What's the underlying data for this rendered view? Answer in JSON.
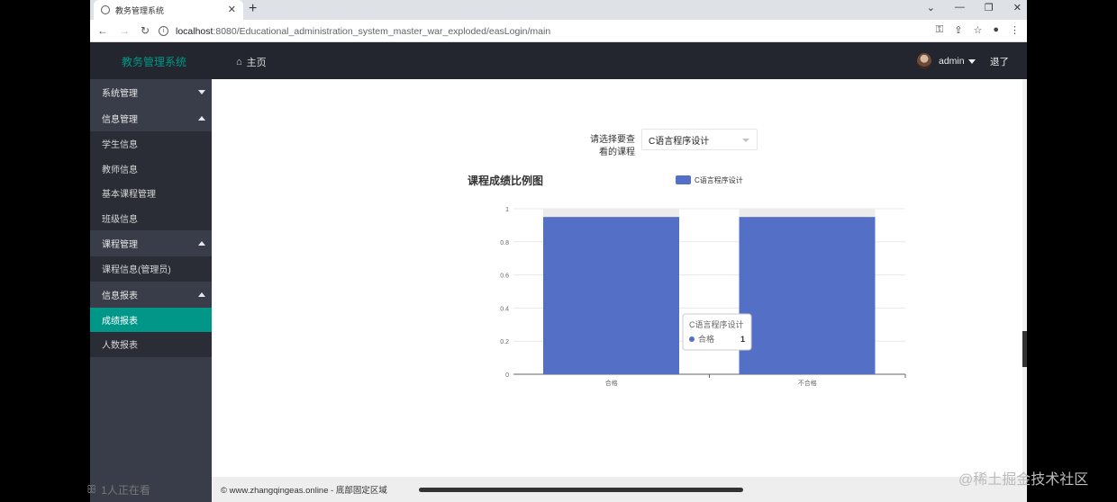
{
  "browser": {
    "tab_title": "教务管理系统",
    "new_tab": "+",
    "url_host": "localhost",
    "url_rest": ":8080/Educational_administration_system_master_war_exploded/easLogin/main"
  },
  "header": {
    "brand": "教务管理系统",
    "home_label": "主页",
    "user_name": "admin",
    "logout_label": "退了"
  },
  "sidebar": {
    "groups": [
      {
        "label": "系统管理",
        "expanded": false
      },
      {
        "label": "信息管理",
        "expanded": true,
        "items": [
          "学生信息",
          "教师信息",
          "基本课程管理",
          "班级信息"
        ]
      },
      {
        "label": "课程管理",
        "expanded": true,
        "items": [
          "课程信息(管理员)"
        ]
      },
      {
        "label": "信息报表",
        "expanded": true,
        "items": [
          "成绩报表",
          "人数报表"
        ]
      }
    ],
    "active_item": "成绩报表"
  },
  "main": {
    "selector_label_line1": "请选择要查",
    "selector_label_line2": "看的课程",
    "selected_course": "C语言程序设计"
  },
  "chart_data": {
    "type": "bar",
    "title": "课程成绩比例图",
    "categories": [
      "合格",
      "不合格"
    ],
    "series": [
      {
        "name": "C语言程序设计",
        "values": [
          0.95,
          0.95
        ]
      }
    ],
    "ylim": [
      0,
      1
    ],
    "yticks": [
      "0",
      "0.2",
      "0.4",
      "0.6",
      "0.8",
      "1"
    ],
    "grid": true,
    "legend_position": "top",
    "bar_color": "#5470c6",
    "tooltip": {
      "title": "C语言程序设计",
      "label": "合格",
      "value": "1"
    }
  },
  "footer": {
    "text": "© www.zhangqingeas.online - 底部固定区域"
  },
  "overlay": {
    "watching": "1人正在看",
    "watermark": "@稀土掘金技术社区"
  },
  "colors": {
    "accent": "#009688",
    "header_bg": "#23262e",
    "sidebar_bg": "#393d49"
  }
}
